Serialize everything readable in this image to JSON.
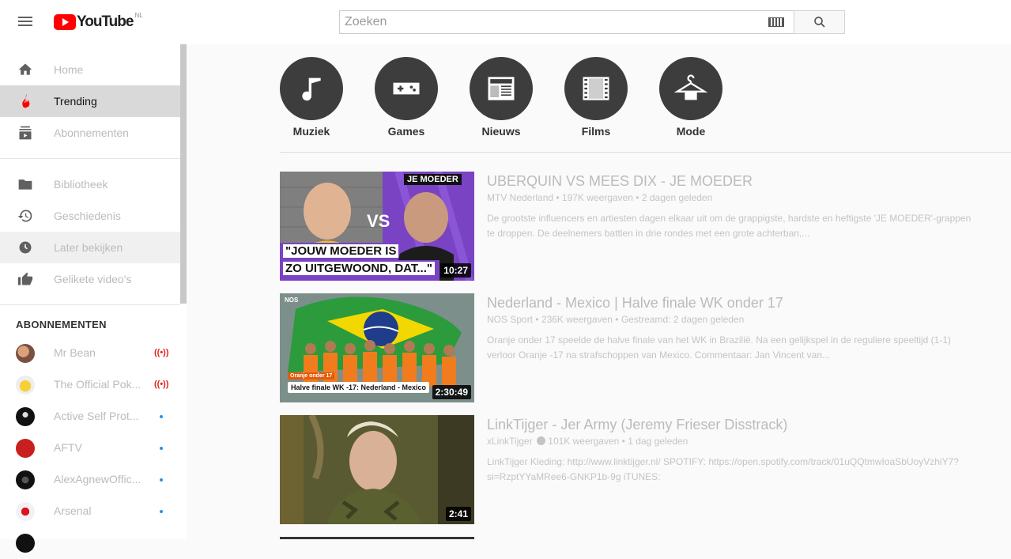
{
  "header": {
    "logo_text": "YouTube",
    "logo_region": "NL",
    "search_placeholder": "Zoeken"
  },
  "sidebar": {
    "nav": [
      {
        "label": "Home",
        "icon": "home-icon"
      },
      {
        "label": "Trending",
        "icon": "flame-icon",
        "active": true
      },
      {
        "label": "Abonnementen",
        "icon": "subscriptions-icon"
      }
    ],
    "library": [
      {
        "label": "Bibliotheek",
        "icon": "folder-icon"
      },
      {
        "label": "Geschiedenis",
        "icon": "history-icon"
      },
      {
        "label": "Later bekijken",
        "icon": "clock-icon"
      },
      {
        "label": "Gelikete video's",
        "icon": "thumbs-up-icon"
      }
    ],
    "subscriptions_title": "ABONNEMENTEN",
    "subscriptions": [
      {
        "label": "Mr Bean",
        "indicator": "live"
      },
      {
        "label": "The Official Pok...",
        "indicator": "live"
      },
      {
        "label": "Active Self Prot...",
        "indicator": "new"
      },
      {
        "label": "AFTV",
        "indicator": "new"
      },
      {
        "label": "AlexAgnewOffic...",
        "indicator": "new"
      },
      {
        "label": "Arsenal",
        "indicator": "new"
      }
    ]
  },
  "categories": [
    {
      "label": "Muziek",
      "icon": "music-note-icon"
    },
    {
      "label": "Games",
      "icon": "gamepad-icon"
    },
    {
      "label": "Nieuws",
      "icon": "newspaper-icon"
    },
    {
      "label": "Films",
      "icon": "film-strip-icon"
    },
    {
      "label": "Mode",
      "icon": "hanger-icon"
    }
  ],
  "videos": [
    {
      "title": "UBERQUIN VS MEES DIX - JE MOEDER",
      "meta": "MTV Nederland • 197K weergaven • 2 dagen geleden",
      "description": "De grootste influencers en artiesten dagen elkaar uit om de grappigste, hardste en heftigste 'JE MOEDER'-grappen te droppen. De deelnemers battlen in drie rondes met een grote achterban,...",
      "duration": "10:27",
      "thumb_text_top": "JE MOEDER",
      "thumb_text_vs": "VS",
      "thumb_caption_1": "\"JOUW MOEDER IS",
      "thumb_caption_2": "ZO UITGEWOOND, DAT...\""
    },
    {
      "title": "Nederland - Mexico | Halve finale WK onder 17",
      "meta": "NOS Sport • 236K weergaven • Gestreamd: 2 dagen geleden",
      "description": "Oranje onder 17 speelde de halve finale van het WK in Brazilië. Na een gelijkspel in de reguliere speeltijd (1-1) verloor Oranje -17 na strafschoppen van Mexico. Commentaar: Jan Vincent van...",
      "duration": "2:30:49",
      "thumb_logo": "NOS",
      "thumb_tag": "Oranje onder 17",
      "thumb_banner": "Halve finale WK -17: Nederland - Mexico"
    },
    {
      "title": "LinkTijger - Jer Army (Jeremy Frieser Disstrack)",
      "channel": "xLinkTijger",
      "meta_rest": "101K weergaven • 1 dag geleden",
      "description": "LinkTijger Kleding: http://www.linktijger.nl/ SPOTIFY: https://open.spotify.com/track/01uQQtmwIoaSbUoyVzhiY7?si=RzptYYaMRee6-GNKP1b-9g iTUNES:",
      "duration": "2:41"
    }
  ]
}
